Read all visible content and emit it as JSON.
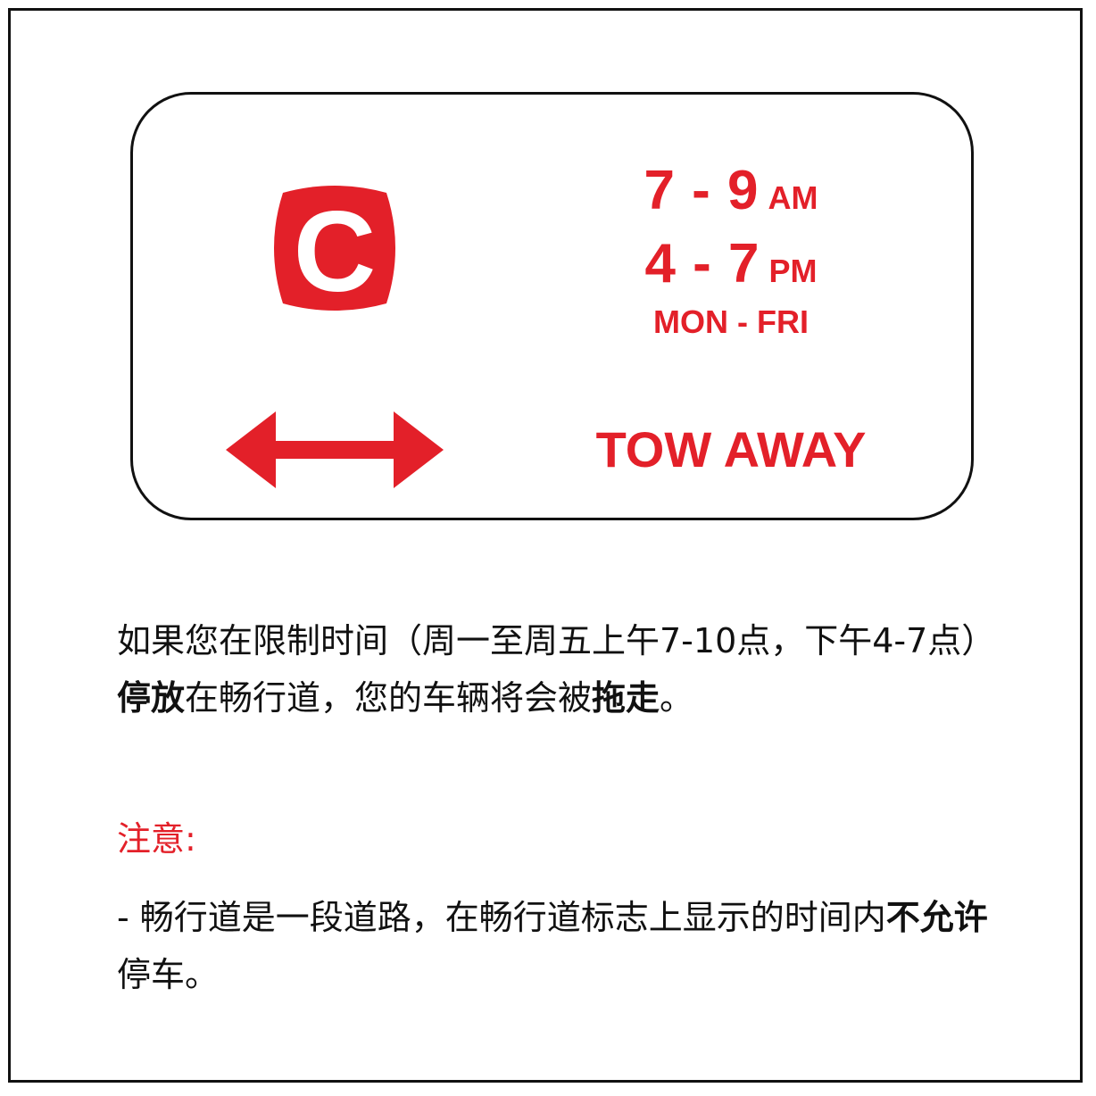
{
  "sign": {
    "badge_letter": "C",
    "time_am": {
      "range": "7 - 9",
      "suffix": "AM"
    },
    "time_pm": {
      "range": "4 - 7",
      "suffix": "PM"
    },
    "days": "MON - FRI",
    "tow": "TOW AWAY",
    "colors": {
      "red": "#e32029",
      "border": "#111111"
    }
  },
  "paragraph1": {
    "part1": "如果您在限制时间（周一至周五上午7-10点，下午4-7点）",
    "bold1": "停放",
    "part2": "在畅行道，您的车辆将会被",
    "bold2": "拖走",
    "part3": "。"
  },
  "note": {
    "title": "注意:",
    "part1": "- 畅行道是一段道路，在畅行道标志上显示的时间内",
    "bold1": "不允许",
    "part2": "停车。"
  }
}
